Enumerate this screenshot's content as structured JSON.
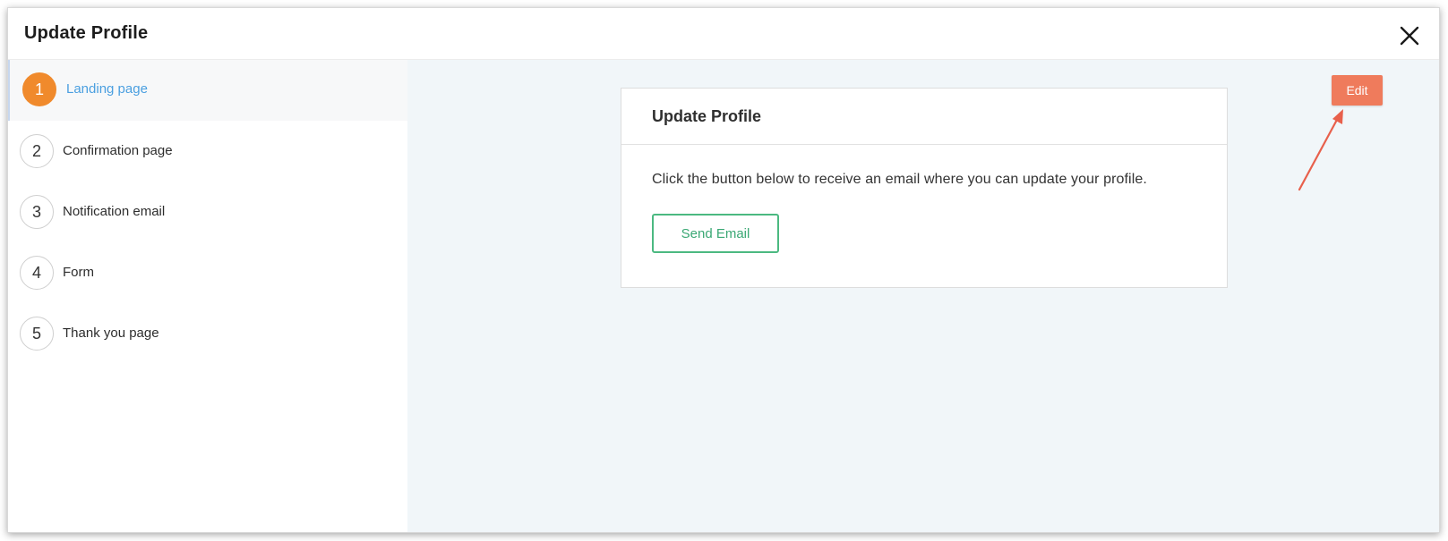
{
  "modal": {
    "title": "Update Profile",
    "close_icon": "close-icon"
  },
  "steps": [
    {
      "number": "1",
      "label": "Landing page",
      "active": true
    },
    {
      "number": "2",
      "label": "Confirmation page",
      "active": false
    },
    {
      "number": "3",
      "label": "Notification email",
      "active": false
    },
    {
      "number": "4",
      "label": "Form",
      "active": false
    },
    {
      "number": "5",
      "label": "Thank you page",
      "active": false
    }
  ],
  "preview": {
    "card_title": "Update Profile",
    "description": "Click the button below to receive an email where you can update your profile.",
    "send_button_label": "Send Email"
  },
  "toolbar": {
    "edit_label": "Edit"
  },
  "colors": {
    "active_step": "#f08a2c",
    "active_label": "#4a9fe0",
    "edit_button": "#ef7b5c",
    "send_button": "#4bb981",
    "annotation_arrow": "#e8604c",
    "content_bg": "#f1f6f9"
  }
}
